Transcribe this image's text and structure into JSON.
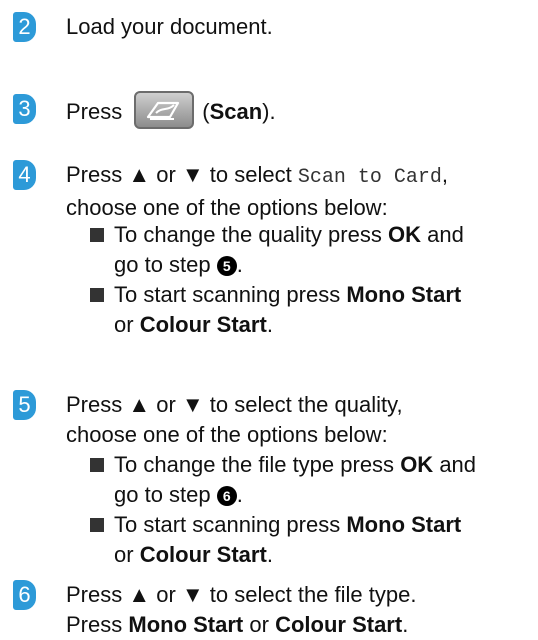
{
  "steps": [
    {
      "number": "2",
      "text": "Load your document."
    },
    {
      "number": "3",
      "prefix": "Press",
      "icon": "scanner-icon",
      "paren_open": "(",
      "bold": "Scan",
      "paren_close": ")."
    },
    {
      "number": "4",
      "line1_pre": "Press ▲ or ▼ to select",
      "line1_mono": "Scan to Card",
      "line1_post": ",",
      "line2": "choose one of the options below:",
      "options": [
        {
          "l1_pre": "To change the quality press",
          "l1_bold": "OK",
          "l1_post": "and",
          "l2_pre": "go to step",
          "l2_ref": "5",
          "l2_post": "."
        },
        {
          "l1_pre": "To start scanning press",
          "l1_bold": "Mono Start",
          "l2_pre": "or",
          "l2_bold": "Colour Start",
          "l2_post": "."
        }
      ]
    },
    {
      "number": "5",
      "line1": "Press ▲ or ▼ to select the quality,",
      "line2": "choose one of the options below:",
      "options": [
        {
          "l1_pre": "To change the file type press",
          "l1_bold": "OK",
          "l1_post": "and",
          "l2_pre": "go to step",
          "l2_ref": "6",
          "l2_post": "."
        },
        {
          "l1_pre": "To start scanning press",
          "l1_bold": "Mono Start",
          "l2_pre": "or",
          "l2_bold": "Colour Start",
          "l2_post": "."
        }
      ]
    },
    {
      "number": "6",
      "line1": "Press ▲ or ▼ to select the file type.",
      "line2_pre": "Press",
      "line2_bold1": "Mono Start",
      "line2_mid": "or",
      "line2_bold2": "Colour Start",
      "line2_post": "."
    }
  ],
  "colors": {
    "step_badge": "#2d9ad8",
    "text": "#111111"
  }
}
